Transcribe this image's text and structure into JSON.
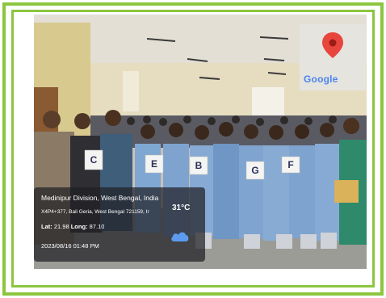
{
  "map": {
    "label": "Google",
    "icon": "map-pin-icon"
  },
  "location": {
    "place": "Medinipur Division, West Bengal, India",
    "address": "X4P4+377, Bali Geria, West Bengal 721159, Ir",
    "lat_label": "Lat:",
    "lat_value": "21.98",
    "long_label": "Long:",
    "long_value": "87.10",
    "datetime": "2023/08/16 01:48 PM",
    "temperature": "31°C",
    "weather_icon": "cloud-icon"
  },
  "signs": [
    "C",
    "E",
    "B",
    "G",
    "F"
  ],
  "colors": {
    "frame": "#8cc63f",
    "map_pin": "#e8453c",
    "cloud": "#5c9bf0"
  }
}
